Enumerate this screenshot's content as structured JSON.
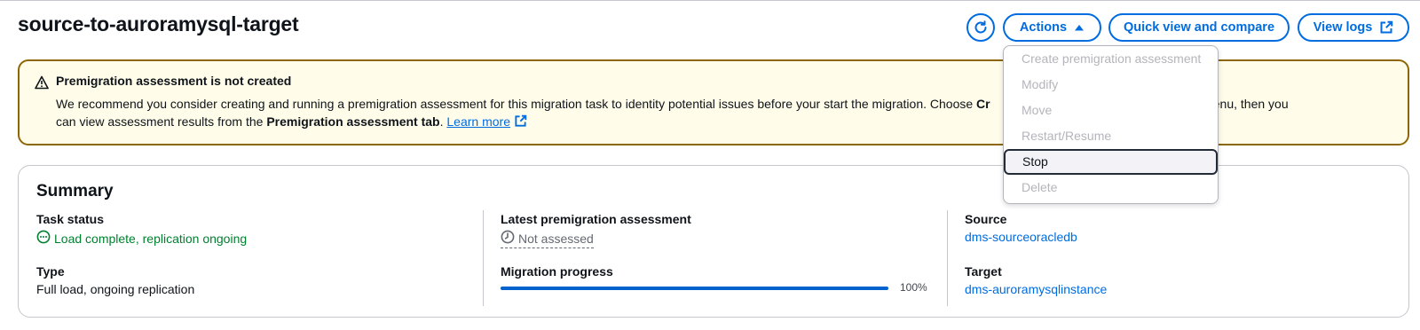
{
  "header": {
    "title": "source-to-auroramysql-target",
    "actions_label": "Actions",
    "quick_view_label": "Quick view and compare",
    "view_logs_label": "View logs"
  },
  "banner": {
    "title": "Premigration assessment is not created",
    "line1_part1": "We recommend you consider creating and running a premigration assessment for this migration task to identity potential issues before your start the migration. Choose ",
    "line1_bold_partial": "Cr",
    "line1_part2": "ne Actions menu, then you",
    "line2_part1": "can view assessment results from the ",
    "line2_bold": "Premigration assessment tab",
    "line2_part2": ". ",
    "learn_more": "Learn more"
  },
  "summary": {
    "title": "Summary",
    "task_status_label": "Task status",
    "task_status_value": "Load complete, replication ongoing",
    "type_label": "Type",
    "type_value": "Full load, ongoing replication",
    "assessment_label": "Latest premigration assessment",
    "assessment_value": "Not assessed",
    "progress_label": "Migration progress",
    "progress_percent": 100,
    "progress_text": "100%",
    "source_label": "Source",
    "source_value": "dms-sourceoracledb",
    "target_label": "Target",
    "target_value": "dms-auroramysqlinstance"
  },
  "actions_menu": {
    "items": [
      {
        "label": "Create premigration assessment",
        "enabled": false
      },
      {
        "label": "Modify",
        "enabled": false
      },
      {
        "label": "Move",
        "enabled": false
      },
      {
        "label": "Restart/Resume",
        "enabled": false
      },
      {
        "label": "Stop",
        "enabled": true,
        "highlighted": true
      },
      {
        "label": "Delete",
        "enabled": false
      }
    ]
  },
  "colors": {
    "accent": "#006ce0",
    "success": "#00802f",
    "warning_border": "#8d6605",
    "warning_bg": "#fffce9"
  },
  "icons": {
    "refresh": "refresh-icon",
    "caret": "caret-up-icon",
    "external": "external-link-icon",
    "warning": "warning-icon",
    "status_ok": "status-in-progress-icon",
    "clock": "clock-icon"
  }
}
